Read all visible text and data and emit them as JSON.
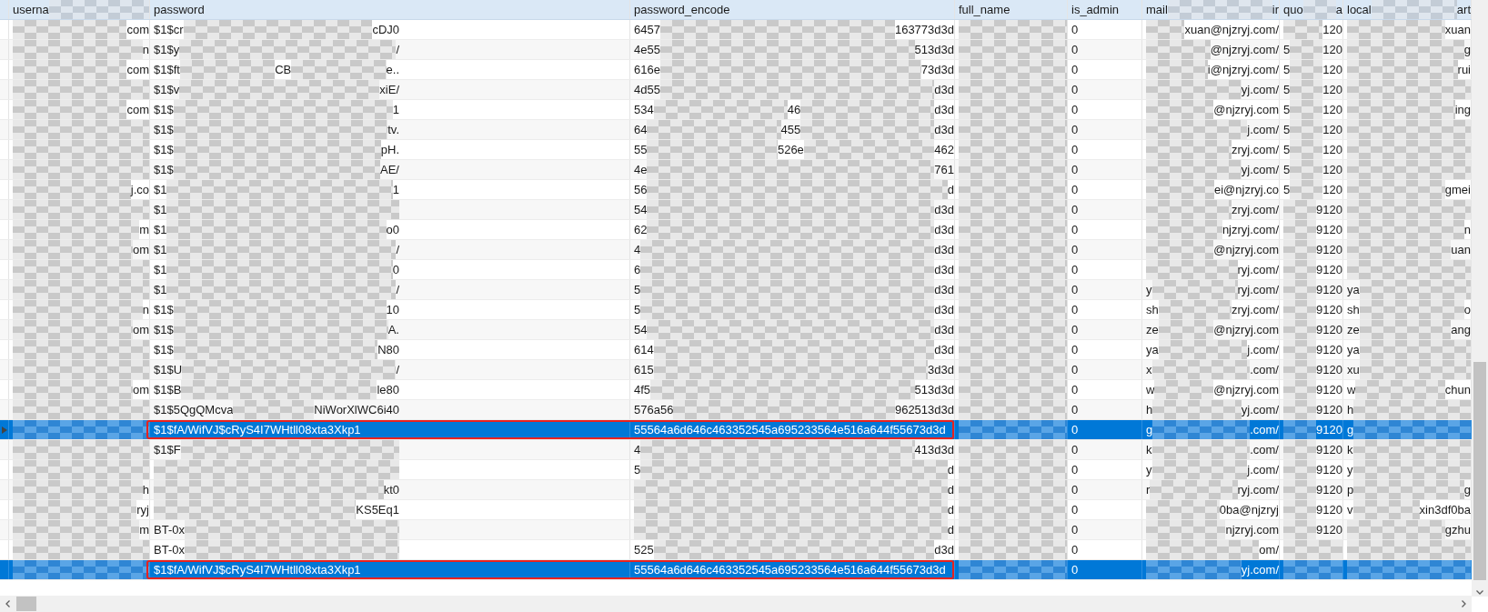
{
  "columns": [
    [
      "userna",
      null
    ],
    [
      "password"
    ],
    [
      "password_encode"
    ],
    [
      "full_name"
    ],
    [
      "is_admin"
    ],
    [
      "mail",
      null,
      "ir"
    ],
    [
      "quo",
      null,
      "a"
    ],
    [
      "local",
      null,
      "art"
    ]
  ],
  "rows": [
    {
      "selected": false,
      "current": false,
      "outlined": false,
      "cells": [
        [
          null,
          "com"
        ],
        [
          "$1$cr",
          null,
          "cDJ0"
        ],
        [
          "6457",
          null,
          "163773d3d"
        ],
        [
          null
        ],
        [
          "0"
        ],
        [
          null,
          "xuan@njzryj.com/"
        ],
        [
          null,
          "120"
        ],
        [
          null,
          "xuan"
        ]
      ]
    },
    {
      "selected": false,
      "current": false,
      "outlined": false,
      "cells": [
        [
          null,
          "n"
        ],
        [
          "$1$y",
          null,
          "/"
        ],
        [
          "4e55",
          null,
          "513d3d"
        ],
        [
          null
        ],
        [
          "0"
        ],
        [
          null,
          "@njzryj.com/"
        ],
        [
          "5",
          null,
          "120"
        ],
        [
          null,
          "g"
        ]
      ]
    },
    {
      "selected": false,
      "current": false,
      "outlined": false,
      "cells": [
        [
          null,
          "com"
        ],
        [
          "$1$ft",
          null,
          "CB",
          null,
          "e.."
        ],
        [
          "616e",
          null,
          "73d3d"
        ],
        [
          null
        ],
        [
          "0"
        ],
        [
          null,
          "i@njzryj.com/"
        ],
        [
          "5",
          null,
          "120"
        ],
        [
          null,
          "rui"
        ]
      ]
    },
    {
      "selected": false,
      "current": false,
      "outlined": false,
      "cells": [
        [
          null
        ],
        [
          "$1$v",
          null,
          "xiE/"
        ],
        [
          "4d55",
          null,
          "d3d"
        ],
        [
          null
        ],
        [
          "0"
        ],
        [
          null,
          "yj.com/"
        ],
        [
          "5",
          null,
          "120"
        ],
        [
          null
        ]
      ]
    },
    {
      "selected": false,
      "current": false,
      "outlined": false,
      "cells": [
        [
          null,
          "com"
        ],
        [
          "$1$",
          null,
          "1"
        ],
        [
          "534",
          null,
          "46",
          null,
          "d3d"
        ],
        [
          null
        ],
        [
          "0"
        ],
        [
          null,
          "@njzryj.com"
        ],
        [
          "5",
          null,
          "120"
        ],
        [
          null,
          "ing"
        ]
      ]
    },
    {
      "selected": false,
      "current": false,
      "outlined": false,
      "cells": [
        [
          null
        ],
        [
          "$1$",
          null,
          "tv."
        ],
        [
          "64",
          null,
          "455",
          null,
          "d3d"
        ],
        [
          null
        ],
        [
          "0"
        ],
        [
          null,
          "j.com/"
        ],
        [
          "5",
          null,
          "120"
        ],
        [
          null
        ]
      ]
    },
    {
      "selected": false,
      "current": false,
      "outlined": false,
      "cells": [
        [
          null
        ],
        [
          "$1$",
          null,
          "pH."
        ],
        [
          "55",
          null,
          "526e",
          null,
          "462"
        ],
        [
          null
        ],
        [
          "0"
        ],
        [
          null,
          "zryj.com/"
        ],
        [
          "5",
          null,
          "120"
        ],
        [
          null
        ]
      ]
    },
    {
      "selected": false,
      "current": false,
      "outlined": false,
      "cells": [
        [
          null
        ],
        [
          "$1$",
          null,
          "AE/"
        ],
        [
          "4e",
          null,
          "761"
        ],
        [
          null
        ],
        [
          "0"
        ],
        [
          null,
          "yj.com/"
        ],
        [
          "5",
          null,
          "120"
        ],
        [
          null
        ]
      ]
    },
    {
      "selected": false,
      "current": false,
      "outlined": false,
      "cells": [
        [
          null,
          "j.co"
        ],
        [
          "$1",
          null,
          "1"
        ],
        [
          "56",
          null,
          "d"
        ],
        [
          null
        ],
        [
          "0"
        ],
        [
          null,
          "ei@njzryj.co"
        ],
        [
          "5",
          null,
          "120"
        ],
        [
          null,
          "gmei"
        ]
      ]
    },
    {
      "selected": false,
      "current": false,
      "outlined": false,
      "cells": [
        [
          null
        ],
        [
          "$1",
          null
        ],
        [
          "54",
          null,
          "d3d"
        ],
        [
          null
        ],
        [
          "0"
        ],
        [
          null,
          "zryj.com/"
        ],
        [
          null,
          "9120"
        ],
        [
          null
        ]
      ]
    },
    {
      "selected": false,
      "current": false,
      "outlined": false,
      "cells": [
        [
          null,
          "m"
        ],
        [
          "$1",
          null,
          "o0"
        ],
        [
          "62",
          null,
          "d3d"
        ],
        [
          null
        ],
        [
          "0"
        ],
        [
          null,
          "njzryj.com/"
        ],
        [
          null,
          "9120"
        ],
        [
          null,
          "n"
        ]
      ]
    },
    {
      "selected": false,
      "current": false,
      "outlined": false,
      "cells": [
        [
          null,
          "om"
        ],
        [
          "$1",
          null,
          "/"
        ],
        [
          "4",
          null,
          "d3d"
        ],
        [
          null
        ],
        [
          "0"
        ],
        [
          null,
          "@njzryj.com"
        ],
        [
          null,
          "9120"
        ],
        [
          null,
          "uan"
        ]
      ]
    },
    {
      "selected": false,
      "current": false,
      "outlined": false,
      "cells": [
        [
          null
        ],
        [
          "$1",
          null,
          "0"
        ],
        [
          "6",
          null,
          "d3d"
        ],
        [
          null
        ],
        [
          "0"
        ],
        [
          null,
          "ryj.com/"
        ],
        [
          null,
          "9120"
        ],
        [
          null
        ]
      ]
    },
    {
      "selected": false,
      "current": false,
      "outlined": false,
      "cells": [
        [
          null
        ],
        [
          "$1",
          null,
          "/"
        ],
        [
          "5",
          null,
          "d3d"
        ],
        [
          null
        ],
        [
          "0"
        ],
        [
          "y",
          null,
          "ryj.com/"
        ],
        [
          null,
          "9120"
        ],
        [
          "ya",
          null
        ]
      ]
    },
    {
      "selected": false,
      "current": false,
      "outlined": false,
      "cells": [
        [
          null,
          "n"
        ],
        [
          "$1$",
          null,
          "10"
        ],
        [
          "5",
          null,
          "d3d"
        ],
        [
          null
        ],
        [
          "0"
        ],
        [
          "sh",
          null,
          "zryj.com/"
        ],
        [
          null,
          "9120"
        ],
        [
          "sh",
          null,
          "o"
        ]
      ]
    },
    {
      "selected": false,
      "current": false,
      "outlined": false,
      "cells": [
        [
          null,
          "om"
        ],
        [
          "$1$",
          null,
          "A."
        ],
        [
          "54",
          null,
          "d3d"
        ],
        [
          null
        ],
        [
          "0"
        ],
        [
          "ze",
          null,
          "@njzryj.com"
        ],
        [
          null,
          "9120"
        ],
        [
          "ze",
          null,
          "ang"
        ]
      ]
    },
    {
      "selected": false,
      "current": false,
      "outlined": false,
      "cells": [
        [
          null
        ],
        [
          "$1$",
          null,
          "N80"
        ],
        [
          "614",
          null,
          "d3d"
        ],
        [
          null
        ],
        [
          "0"
        ],
        [
          "ya",
          null,
          "j.com/"
        ],
        [
          null,
          "9120"
        ],
        [
          "ya",
          null
        ]
      ]
    },
    {
      "selected": false,
      "current": false,
      "outlined": false,
      "cells": [
        [
          null
        ],
        [
          "$1$U",
          null,
          "/"
        ],
        [
          "615",
          null,
          "3d3d"
        ],
        [
          null
        ],
        [
          "0"
        ],
        [
          "x",
          null,
          ".com/"
        ],
        [
          null,
          "9120"
        ],
        [
          "xu",
          null
        ]
      ]
    },
    {
      "selected": false,
      "current": false,
      "outlined": false,
      "cells": [
        [
          null,
          "om"
        ],
        [
          "$1$B",
          null,
          "le80"
        ],
        [
          "4f5",
          null,
          "513d3d"
        ],
        [
          null
        ],
        [
          "0"
        ],
        [
          "w",
          null,
          "@njzryj.com"
        ],
        [
          null,
          "9120"
        ],
        [
          "w",
          null,
          "chun"
        ]
      ]
    },
    {
      "selected": false,
      "current": false,
      "outlined": false,
      "cells": [
        [
          null
        ],
        [
          "$1$5QgQMcva",
          null,
          "NiWorXlWC6i40"
        ],
        [
          "576a56",
          null,
          "962513d3d"
        ],
        [
          null
        ],
        [
          "0"
        ],
        [
          "h",
          null,
          "yj.com/"
        ],
        [
          null,
          "9120"
        ],
        [
          "h",
          null
        ]
      ]
    },
    {
      "selected": true,
      "current": true,
      "outlined": true,
      "cells": [
        [
          null
        ],
        [
          "$1$fA/WifVJ$cRyS4I7WHtll08xta3Xkp1"
        ],
        [
          "55564a6d646c463352545a695233564e516a644f55673d3d"
        ],
        [
          null
        ],
        [
          "0"
        ],
        [
          "g",
          null,
          ".com/"
        ],
        [
          null,
          "9120"
        ],
        [
          "g",
          null
        ]
      ]
    },
    {
      "selected": false,
      "current": false,
      "outlined": false,
      "cells": [
        [
          null
        ],
        [
          "$1$F",
          null
        ],
        [
          "4",
          null,
          "413d3d"
        ],
        [
          null
        ],
        [
          "0"
        ],
        [
          "k",
          null,
          ".com/"
        ],
        [
          null,
          "9120"
        ],
        [
          "k",
          null
        ]
      ]
    },
    {
      "selected": false,
      "current": false,
      "outlined": false,
      "cells": [
        [
          null
        ],
        [
          null
        ],
        [
          "5",
          null,
          "d"
        ],
        [
          null
        ],
        [
          "0"
        ],
        [
          "y",
          null,
          "j.com/"
        ],
        [
          null,
          "9120"
        ],
        [
          "y",
          null
        ]
      ]
    },
    {
      "selected": false,
      "current": false,
      "outlined": false,
      "cells": [
        [
          null,
          "h"
        ],
        [
          null,
          "kt0"
        ],
        [
          null,
          "d"
        ],
        [
          null
        ],
        [
          "0"
        ],
        [
          "r",
          null,
          "ryj.com/"
        ],
        [
          null,
          "9120"
        ],
        [
          "p",
          null,
          "g"
        ]
      ]
    },
    {
      "selected": false,
      "current": false,
      "outlined": false,
      "cells": [
        [
          null,
          "ryj"
        ],
        [
          null,
          "KS5Eq1"
        ],
        [
          null,
          "d"
        ],
        [
          null
        ],
        [
          "0"
        ],
        [
          null,
          "0ba@njzryj"
        ],
        [
          null,
          "9120"
        ],
        [
          "v",
          null,
          "xin3df0ba"
        ]
      ]
    },
    {
      "selected": false,
      "current": false,
      "outlined": false,
      "cells": [
        [
          null,
          "m"
        ],
        [
          "BT-0x",
          null
        ],
        [
          null,
          "d"
        ],
        [
          null
        ],
        [
          "0"
        ],
        [
          null,
          "njzryj.com"
        ],
        [
          null,
          "9120"
        ],
        [
          null,
          "gzhu"
        ]
      ]
    },
    {
      "selected": false,
      "current": false,
      "outlined": false,
      "cells": [
        [
          null
        ],
        [
          "BT-0x",
          null
        ],
        [
          "525",
          null,
          "d3d"
        ],
        [
          null
        ],
        [
          "0"
        ],
        [
          null,
          "om/"
        ],
        [
          null
        ],
        [
          null
        ]
      ]
    },
    {
      "selected": true,
      "current": false,
      "outlined": true,
      "cells": [
        [
          null
        ],
        [
          "$1$fA/WifVJ$cRyS4I7WHtll08xta3Xkp1"
        ],
        [
          "55564a6d646c463352545a695233564e516a644f55673d3d"
        ],
        [
          null
        ],
        [
          "0"
        ],
        [
          null,
          "yj.com/"
        ],
        [
          null
        ],
        [
          null
        ]
      ]
    }
  ]
}
